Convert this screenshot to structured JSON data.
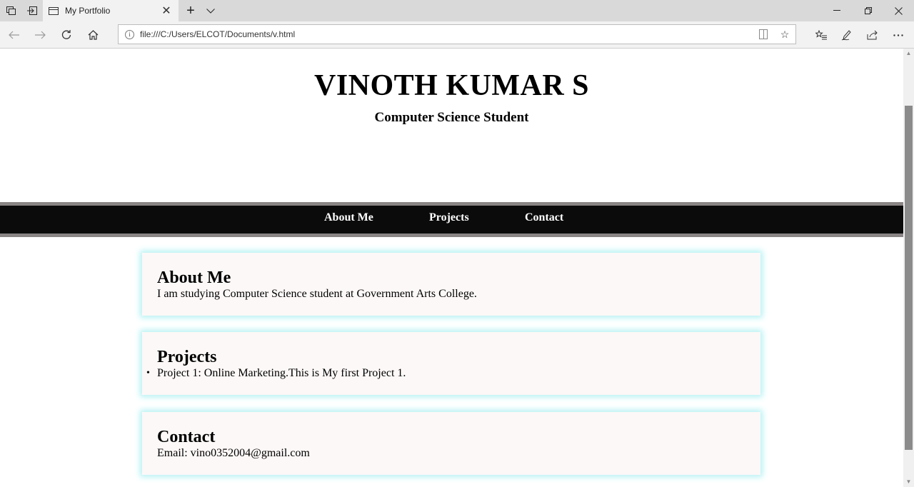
{
  "browser": {
    "tab_title": "My Portfolio",
    "url": "file:///C:/Users/ELCOT/Documents/v.html"
  },
  "header": {
    "title": "VINOTH KUMAR S",
    "subtitle": "Computer Science Student"
  },
  "nav": {
    "items": [
      {
        "label": "About Me"
      },
      {
        "label": "Projects"
      },
      {
        "label": "Contact"
      }
    ]
  },
  "sections": {
    "about": {
      "heading": "About Me",
      "text": "I am studying Computer Science student at Government Arts College."
    },
    "projects": {
      "heading": "Projects",
      "items": [
        "Project 1: Online Marketing.This is My first Project 1."
      ]
    },
    "contact": {
      "heading": "Contact",
      "email": "Email: vino0352004@gmail.com"
    }
  },
  "colors": {
    "nav_background": "#0b0b0b",
    "nav_border": "#8a8585",
    "card_background": "#fcf8f7",
    "card_glow": "#b5f1f3"
  },
  "icons": [
    "tab-actions-icon",
    "set-aside-tabs-icon",
    "page-icon",
    "close-icon",
    "new-tab-icon",
    "tab-preview-icon",
    "minimize-icon",
    "restore-icon",
    "window-close-icon",
    "back-icon",
    "forward-icon",
    "refresh-icon",
    "home-icon",
    "info-icon",
    "reading-view-icon",
    "favorite-star-icon",
    "favorites-hub-icon",
    "pen-icon",
    "share-icon",
    "more-icon"
  ]
}
